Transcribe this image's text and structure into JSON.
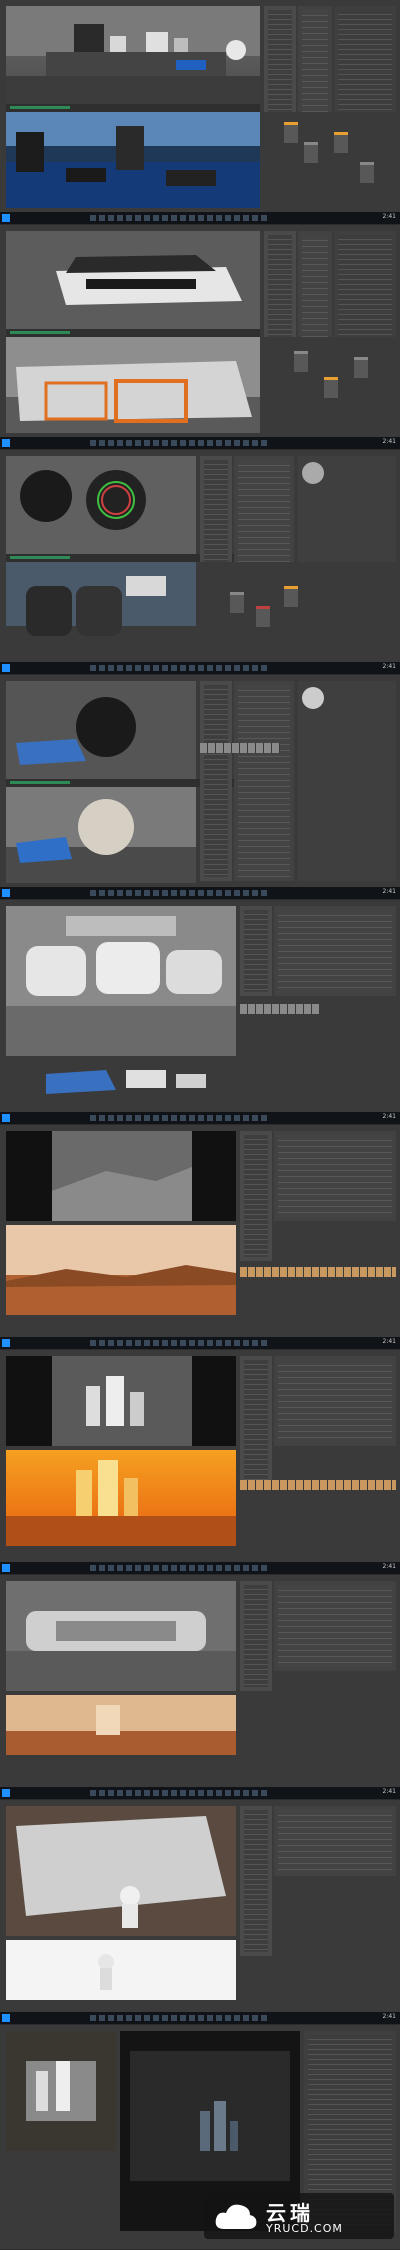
{
  "taskbar": {
    "clock": "2:41"
  },
  "watermark": {
    "brand_cn": "云瑞",
    "brand_url": "YRUCD.COM"
  },
  "colors": {
    "accent_orange": "#e8a030",
    "panel_dark": "#3a3a3a",
    "viewport_grey": "#5a5a5a"
  },
  "icons": [
    "windows-start-icon",
    "cloud-logo-icon"
  ]
}
